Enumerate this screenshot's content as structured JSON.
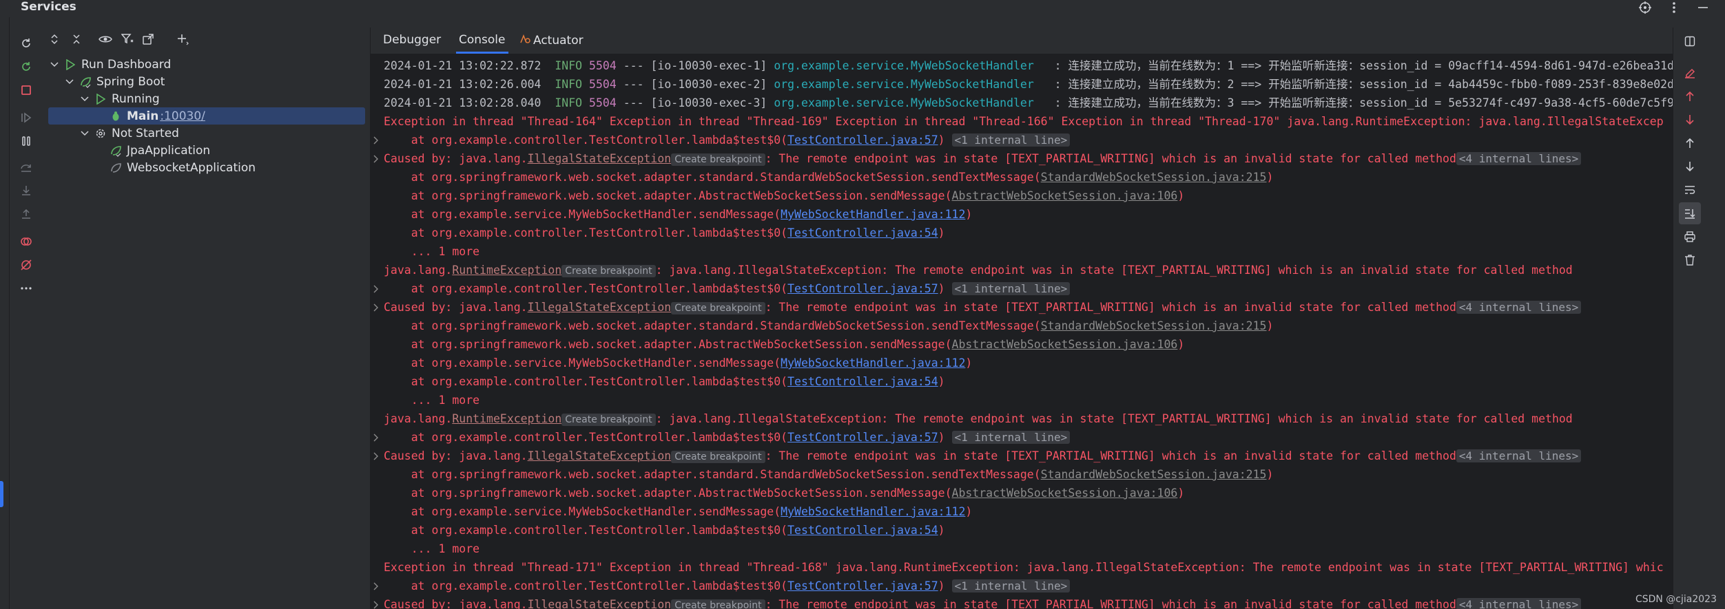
{
  "window": {
    "title": "Services",
    "icons": [
      "target-icon",
      "more-vertical-icon",
      "minimize-icon"
    ]
  },
  "actions": [
    "rerun-icon",
    "rerun-debug-icon",
    "stop-icon",
    "resume-icon",
    "pause-icon",
    "step-over-icon",
    "step-into-icon",
    "step-out-icon",
    "view-breakpoints-icon",
    "mute-breakpoints-icon",
    "more-icon"
  ],
  "tree_toolbar": [
    "expand-all-icon",
    "collapse-all-icon",
    "view-options-icon",
    "filter-icon",
    "new-window-icon",
    "add-service-icon"
  ],
  "tree": {
    "run_dashboard": "Run Dashboard",
    "spring_boot": "Spring Boot",
    "running": "Running",
    "main_label": "Main",
    "main_port": ":10030/",
    "not_started": "Not Started",
    "jpa": "JpaApplication",
    "websocket": "WebsocketApplication"
  },
  "tabs": {
    "debugger": "Debugger",
    "console": "Console",
    "actuator": "Actuator"
  },
  "console": {
    "log": [
      {
        "ts": "2024-01-21 13:02:22.872",
        "level": "INFO",
        "pid": "5504",
        "sep": "---",
        "thread": "[io-10030-exec-1]",
        "cls": "org.example.service.MyWebSocketHandler",
        "msg": ": 连接建立成功，当前在线数为：1 ==> 开始监听新连接：session_id = 09acff14-4594-8d61-947d-e26bea31d"
      },
      {
        "ts": "2024-01-21 13:02:26.004",
        "level": "INFO",
        "pid": "5504",
        "sep": "---",
        "thread": "[io-10030-exec-2]",
        "cls": "org.example.service.MyWebSocketHandler",
        "msg": ": 连接建立成功，当前在线数为：2 ==> 开始监听新连接：session_id = 4ab4459c-fbb0-f089-253f-839e8e02d"
      },
      {
        "ts": "2024-01-21 13:02:28.040",
        "level": "INFO",
        "pid": "5504",
        "sep": "---",
        "thread": "[io-10030-exec-3]",
        "cls": "org.example.service.MyWebSocketHandler",
        "msg": ": 连接建立成功，当前在线数为：3 ==> 开始监听新连接：session_id = 5e53274f-c497-9a38-4cf5-60de7c5f9"
      }
    ],
    "exc_line_1": "Exception in thread \"Thread-164\" Exception in thread \"Thread-169\" Exception in thread \"Thread-166\" Exception in thread \"Thread-170\" java.lang.RuntimeException: java.lang.IllegalStateExcep",
    "exc_line_2": "Exception in thread \"Thread-171\" Exception in thread \"Thread-168\" java.lang.RuntimeException: java.lang.IllegalStateException: The remote endpoint was in state [TEXT_PARTIAL_WRITING] whic",
    "at_lambda": "    at org.example.controller.TestController.lambda$test$0(",
    "link_57": "TestController.java:57",
    "link_54": "TestController.java:54",
    "internal_line": "<1 internal line>",
    "internal_lines": "<4 internal lines>",
    "caused_prefix": "Caused by: java.lang.",
    "illegal_state": "IllegalStateException",
    "create_bp": "Create breakpoint",
    "caused_suffix": ": The remote endpoint was in state [TEXT_PARTIAL_WRITING] which is an invalid state for called method",
    "at_standard": "    at org.springframework.web.socket.adapter.standard.StandardWebSocketSession.sendTextMessage(",
    "link_standard": "StandardWebSocketSession.java:215",
    "at_abstract": "    at org.springframework.web.socket.adapter.AbstractWebSocketSession.sendMessage(",
    "link_abstract": "AbstractWebSocketSession.java:106",
    "at_handler": "    at org.example.service.MyWebSocketHandler.sendMessage(",
    "link_handler": "MyWebSocketHandler.java:112",
    "more": "    ... 1 more",
    "rt_prefix": "java.lang.",
    "runtime_exc": "RuntimeException",
    "rt_suffix": ": java.lang.IllegalStateException: The remote endpoint was in state [TEXT_PARTIAL_WRITING] which is an invalid state for called method",
    "close_paren": ")"
  },
  "right_tools": [
    "layout-icon",
    "clear-red-icon",
    "up-red-icon",
    "down-red-icon",
    "up-icon",
    "down-icon",
    "soft-wrap-icon",
    "scroll-end-icon",
    "print-icon",
    "trash-icon"
  ],
  "watermark": "CSDN @cjia2023",
  "colors": {
    "accent": "#3574f0",
    "error": "#f75464",
    "info": "#6aab73",
    "class": "#2aacb8",
    "link": "#548af7"
  }
}
